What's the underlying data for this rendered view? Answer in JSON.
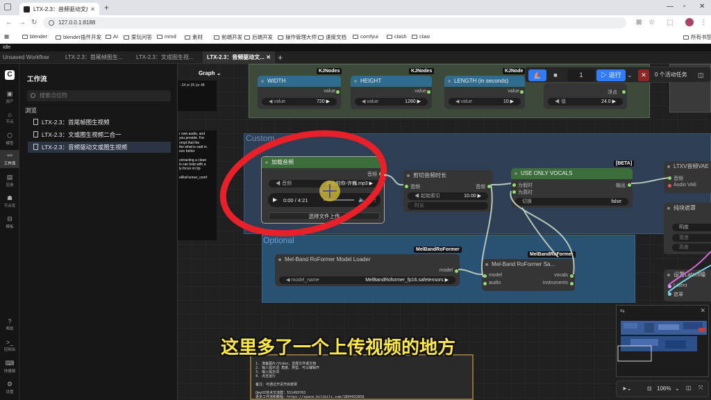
{
  "browser": {
    "tab_title": "LTX-2.3：音频驱动文成图生视频",
    "url": "127.0.0.1:8188",
    "bookmarks": [
      "blender",
      "blender插件开发",
      "AI",
      "爱玩问答",
      "mmd",
      "素材",
      "前端开发",
      "后端开发",
      "操作管理大师",
      "速度文档",
      "comfyui",
      "clash",
      "claw"
    ],
    "bookmarks_all": "所有书签"
  },
  "app": {
    "status": "Idle",
    "tabs": [
      "Unsaved Workflow",
      "LTX-2.3：首尾帧图生...",
      "LTX-2.3：文成图生视...",
      "LTX-2.3：音频驱动文..."
    ],
    "active_tab_index": 3
  },
  "rail": {
    "items": [
      "资产",
      "节点",
      "模型",
      "工作流",
      "应用",
      "节点库",
      "模板"
    ],
    "bottom_items": [
      "帮助",
      "控制台",
      "快捷键",
      "设置"
    ]
  },
  "sidebar": {
    "title": "工作流",
    "search_placeholder": "搜索点位符",
    "browse_label": "浏览",
    "workflows": [
      "LTX-2.3：首尾帧图生视频",
      "LTX-2.3：文或图生视频二合一",
      "LTX-2.3：音频驱动文或图生视频"
    ],
    "selected_index": 2
  },
  "canvas": {
    "graph_label": "Graph",
    "top_note": ": 24 or 25 (or 48",
    "group_custom": "Custom",
    "group_optional": "Optional",
    "nodes": {
      "width": {
        "tag": "KJNodes",
        "title": "WIDTH",
        "out": "value",
        "field_label": "value",
        "field_value": "720"
      },
      "height": {
        "tag": "KJNodes",
        "title": "HEIGHT",
        "out": "value",
        "field_label": "value",
        "field_value": "1280"
      },
      "length": {
        "tag": "KJNode",
        "title": "LENGTH (in seconds)",
        "out": "value",
        "field_label": "value",
        "field_value": "10"
      },
      "float": {
        "out": "浮点",
        "field_label": "值",
        "field_value": "24.0"
      },
      "load_audio": {
        "title": "加载音频",
        "out": "音频",
        "field_label": "音频",
        "field_value": "自由的你-许巍.mp3",
        "time": "0:00 / 4:21",
        "upload": "选择文件上传"
      },
      "trim_audio": {
        "title": "剪切音频时长",
        "in": "音频",
        "out": "音频",
        "field_label": "起始索引",
        "field_value": "10.00",
        "field2": "时长"
      },
      "use_vocals": {
        "tag": "[BETA]",
        "title": "USE ONLY VOCALS",
        "in1": "为假时",
        "in2": "为真时",
        "out": "输出",
        "toggle_label": "切换",
        "toggle_value": "false"
      },
      "ltxv_vae": {
        "title": "LTXV音频VAE",
        "in": "音频",
        "in2": "Audio VAE"
      },
      "pure_sep": {
        "title": "纯块遮罩",
        "f1": "明度",
        "f2": "宽度",
        "f3": "高度"
      },
      "latent_mask": {
        "title": "设置Latent噪",
        "in1": "Latent",
        "in2": "遮罩"
      },
      "melband_loader": {
        "tag": "MelBandRoFormer",
        "title": "Mel-Band RoFormer Model Loader",
        "out": "model",
        "field_label": "model_name",
        "field_value": "MelBandRoformer_fp16.safetensors"
      },
      "melband_sampler": {
        "tag": "MelBandRoFormer",
        "title": "Mel-Band RoFormer Sa...",
        "in1": "model",
        "in2": "audio",
        "out1": "vocals",
        "out2": "instruments"
      }
    },
    "side_note_lines": [
      "r own audio, and",
      "you provide. For",
      "ompt that the",
      "the what is said in",
      "een better",
      "",
      "extracting a clean",
      "ls can help with a",
      "ly focus on lip-",
      "",
      "elRoFormer_comf"
    ],
    "note_lines": [
      "1. 准备图片/Video，选择文件或文档",
      "2. 输入提示词 角度、类型、可以编辑开",
      "3. 输入提示词",
      "4. 点击运行",
      "",
      "备注：可通过开关开启遮罩",
      "",
      "QmyUI技术交流群：551493703",
      "更多工作流和教程：https://space.bilibili.com/1894432858"
    ],
    "subtitle": "这里多了一个上传视频的地方"
  },
  "toolbar": {
    "queue_count": "1",
    "run_label": "运行",
    "active_tasks": "0 个活动任务"
  },
  "zoom": {
    "level": "106%"
  },
  "colors": {
    "accent": "#2f7cf6",
    "node_blue": "#2f6d8f",
    "node_green": "#3c6e3c",
    "highlight_red": "#e8202a",
    "subtitle_yellow": "#ffe84a"
  }
}
